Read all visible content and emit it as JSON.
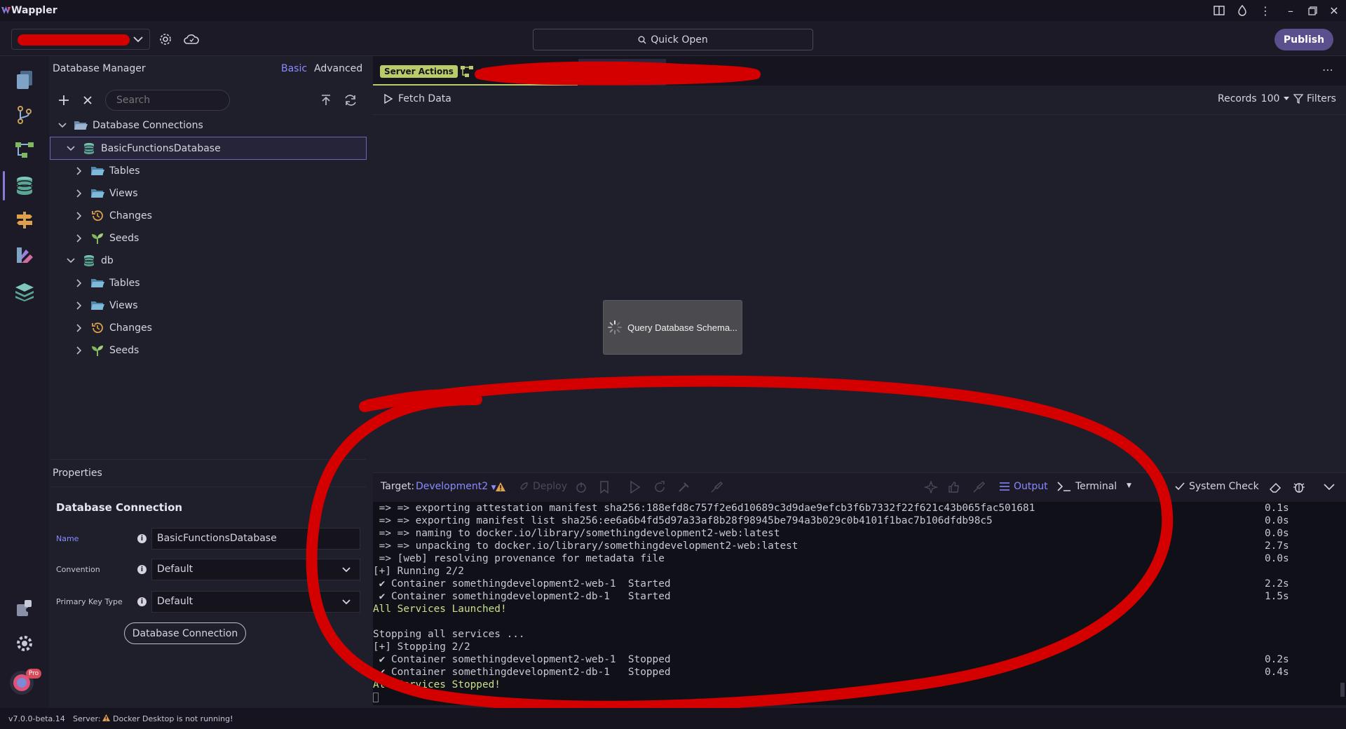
{
  "app": {
    "title": "Wappler"
  },
  "toolbar": {
    "quick_open": "Quick Open",
    "publish": "Publish"
  },
  "left_panel": {
    "title": "Database Manager",
    "modes": {
      "basic": "Basic",
      "advanced": "Advanced"
    },
    "search_placeholder": "Search",
    "tree": {
      "root": "Database Connections",
      "connections": [
        {
          "name": "BasicFunctionsDatabase",
          "children": [
            "Tables",
            "Views",
            "Changes",
            "Seeds"
          ]
        },
        {
          "name": "db",
          "children": [
            "Tables",
            "Views",
            "Changes",
            "Seeds"
          ]
        }
      ]
    }
  },
  "properties": {
    "title": "Properties",
    "heading": "Database Connection",
    "fields": {
      "name": {
        "label": "Name",
        "value": "BasicFunctionsDatabase"
      },
      "convention": {
        "label": "Convention",
        "value": "Default"
      },
      "primary_key": {
        "label": "Primary Key Type",
        "value": "Default"
      }
    },
    "button": "Database Connection"
  },
  "tabs": {
    "server_actions": "Server Actions"
  },
  "main": {
    "fetch_data": "Fetch Data",
    "records_label": "Records",
    "records_value": "100",
    "filters": "Filters",
    "loading_text": "Query Database Schema..."
  },
  "output_bar": {
    "target_label": "Target:",
    "target_value": "Development2",
    "deploy": "Deploy",
    "output": "Output",
    "terminal": "Terminal",
    "system_check": "System Check"
  },
  "console": {
    "lines": [
      {
        "text": " => => exporting attestation manifest sha256:188efd8c757f2e6d10689c3d9dae9efcb3f6b7332f22f621c43b065fac501681",
        "time": "0.1s"
      },
      {
        "text": " => => exporting manifest list sha256:ee6a6b4fd5d97a33af8b28f98945be794a3b029c0b4101f1bac7b106dfdb98c5",
        "time": "0.0s"
      },
      {
        "text": " => => naming to docker.io/library/somethingdevelopment2-web:latest",
        "time": "0.0s"
      },
      {
        "text": " => => unpacking to docker.io/library/somethingdevelopment2-web:latest",
        "time": "2.7s"
      },
      {
        "text": " => [web] resolving provenance for metadata file",
        "time": "0.0s"
      },
      {
        "text": "[+] Running 2/2",
        "time": ""
      },
      {
        "text": " ✔ Container somethingdevelopment2-web-1  Started",
        "time": "2.2s"
      },
      {
        "text": " ✔ Container somethingdevelopment2-db-1   Started",
        "time": "1.5s"
      },
      {
        "text": "All Services Launched!",
        "time": ""
      },
      {
        "text": "",
        "time": ""
      },
      {
        "text": "Stopping all services ...",
        "time": ""
      },
      {
        "text": "[+] Stopping 2/2",
        "time": ""
      },
      {
        "text": " ✔ Container somethingdevelopment2-web-1  Stopped",
        "time": "0.2s"
      },
      {
        "text": " ✔ Container somethingdevelopment2-db-1   Stopped",
        "time": "0.4s"
      },
      {
        "text": "All Services Stopped!",
        "time": ""
      }
    ]
  },
  "status_bar": {
    "version": "v7.0.0-beta.14",
    "server_label": "Server:",
    "server_message": "Docker Desktop is not running!"
  },
  "badges": {
    "pro": "Pro"
  },
  "colors": {
    "accent": "#8b7bd8",
    "publish": "#5b4f8d",
    "server_actions_tab": "#b9cc6a",
    "terminal_green": "#c8e08a",
    "annotation_red": "#d40000"
  }
}
